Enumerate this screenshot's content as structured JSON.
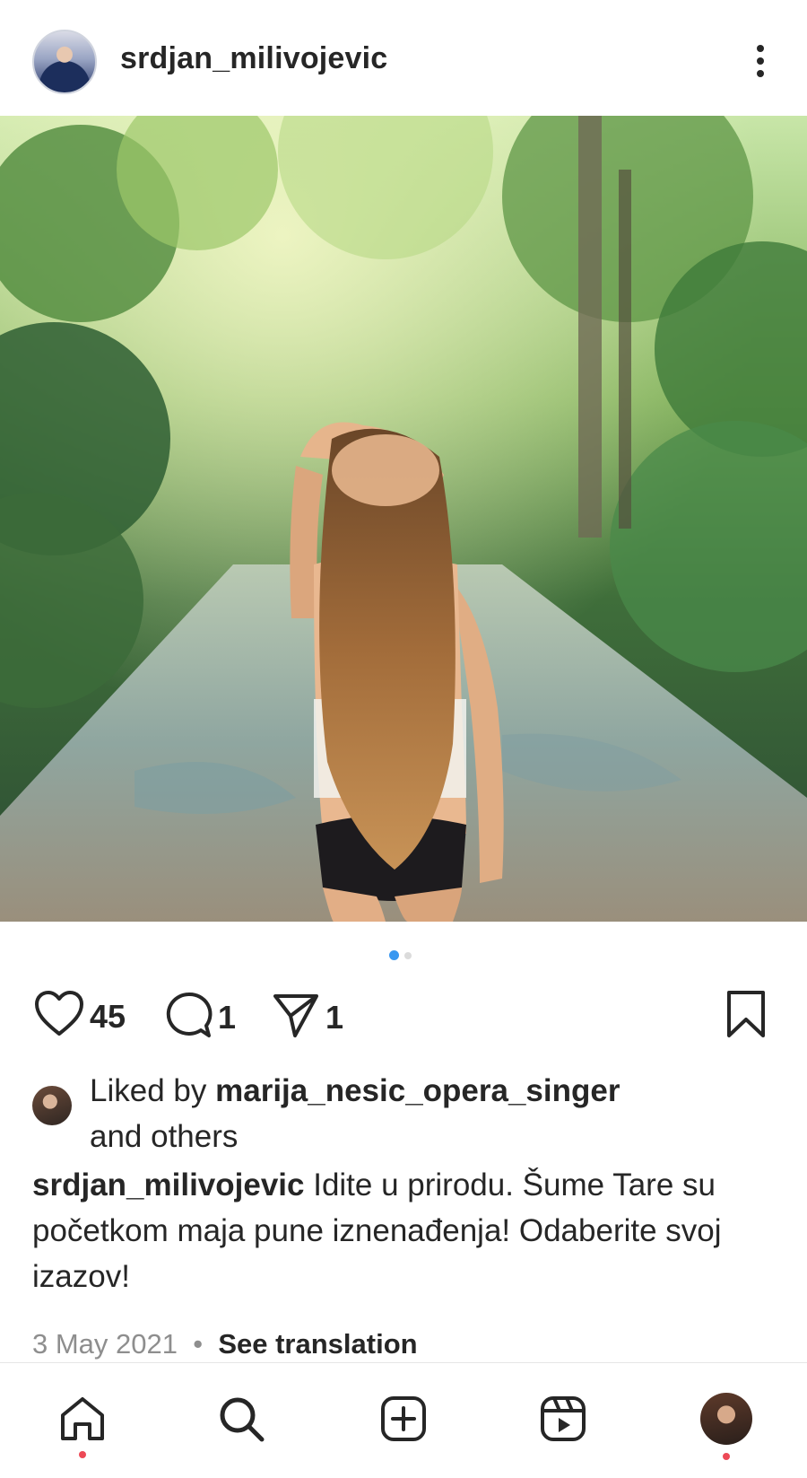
{
  "header": {
    "username": "srdjan_milivojevic"
  },
  "post": {
    "carousel_index": 1,
    "carousel_total": 2,
    "likes": "45",
    "comments": "1",
    "shares": "1"
  },
  "liked_by": {
    "prefix": "Liked by",
    "user": "marija_nesic_opera_singer",
    "suffix": "and others"
  },
  "caption": {
    "username": "srdjan_milivojevic",
    "text": "Idite u prirodu. Šume Tare su početkom maja pune iznenađenja! Odaberite svoj izazov!"
  },
  "meta": {
    "date": "3 May 2021",
    "separator": "•",
    "see_translation": "See translation"
  },
  "colors": {
    "active_dot": "#3897f0",
    "inactive_dot": "#dbdbdb",
    "notification_dot": "#ed4956"
  }
}
